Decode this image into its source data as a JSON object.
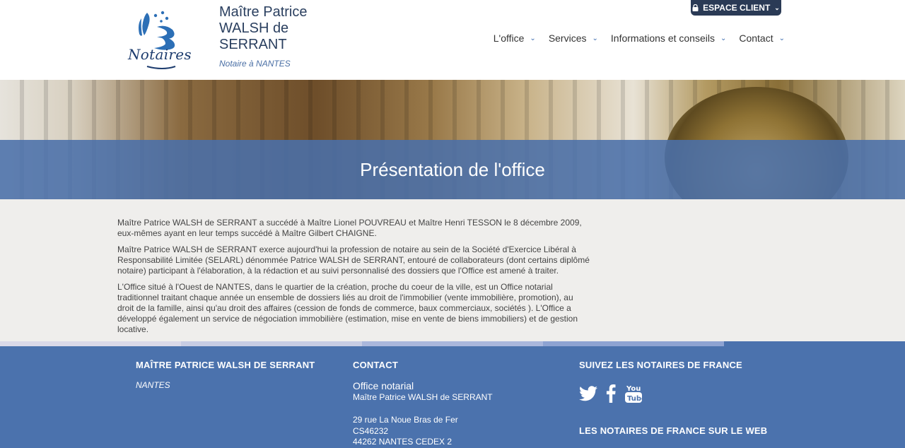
{
  "header": {
    "logo_text": "Notaires",
    "office_name": "Maître Patrice WALSH de SERRANT",
    "office_subtitle": "Notaire à NANTES",
    "espace_client": "ESPACE CLIENT"
  },
  "nav": {
    "items": [
      {
        "label": "L'office"
      },
      {
        "label": "Services"
      },
      {
        "label": "Informations et conseils"
      },
      {
        "label": "Contact"
      }
    ]
  },
  "banner": {
    "title": "Présentation de l'office"
  },
  "content": {
    "paragraphs": [
      "Maître Patrice WALSH de SERRANT a succédé à Maître Lionel POUVREAU et Maître Henri TESSON le 8 décembre 2009, eux-mêmes ayant en leur temps succédé à Maître Gilbert CHAIGNE.",
      "Maître Patrice WALSH de SERRANT exerce aujourd'hui la profession de notaire au sein de la Société d'Exercice Libéral à Responsabilité Limitée (SELARL) dénommée Patrice WALSH de SERRANT, entouré de collaborateurs (dont certains diplômé notaire) participant à l'élaboration, à la rédaction et au suivi personnalisé des dossiers que l'Office est amené à traiter.",
      "L'Office situé à l'Ouest de NANTES, dans le quartier de la création, proche du coeur de la ville, est un Office notarial traditionnel traitant chaque année un ensemble de dossiers liés au droit de l'immobilier (vente immobilière, promotion), au droit de la famille, ainsi qu'au droit des affaires (cession de fonds de commerce, baux commerciaux, sociétés ). L'Office a développé également un service de négociation immobilière (estimation, mise en vente de biens immobiliers) et de gestion locative."
    ]
  },
  "footer": {
    "col1_title": "MAÎTRE PATRICE WALSH DE SERRANT",
    "col1_city": "NANTES",
    "col2_title": "CONTACT",
    "contact_type": "Office notarial",
    "contact_name": "Maître Patrice WALSH de SERRANT",
    "address_line1": "29 rue La Noue Bras de Fer",
    "address_line2": "CS46232",
    "address_line3": "44262 NANTES CEDEX 2",
    "col3_title": "SUIVEZ LES NOTAIRES DE FRANCE",
    "col3b_title": "LES NOTAIRES DE FRANCE SUR LE WEB",
    "strip_colors": [
      "#dad9e8",
      "#c7cce3",
      "#aab7dc",
      "#8ea3d2",
      "#4b72ad"
    ]
  },
  "colors": {
    "brand_blue": "#4b72ad",
    "espace_client_bg": "#2a3a55",
    "nav_chevron": "#3d6db0"
  }
}
